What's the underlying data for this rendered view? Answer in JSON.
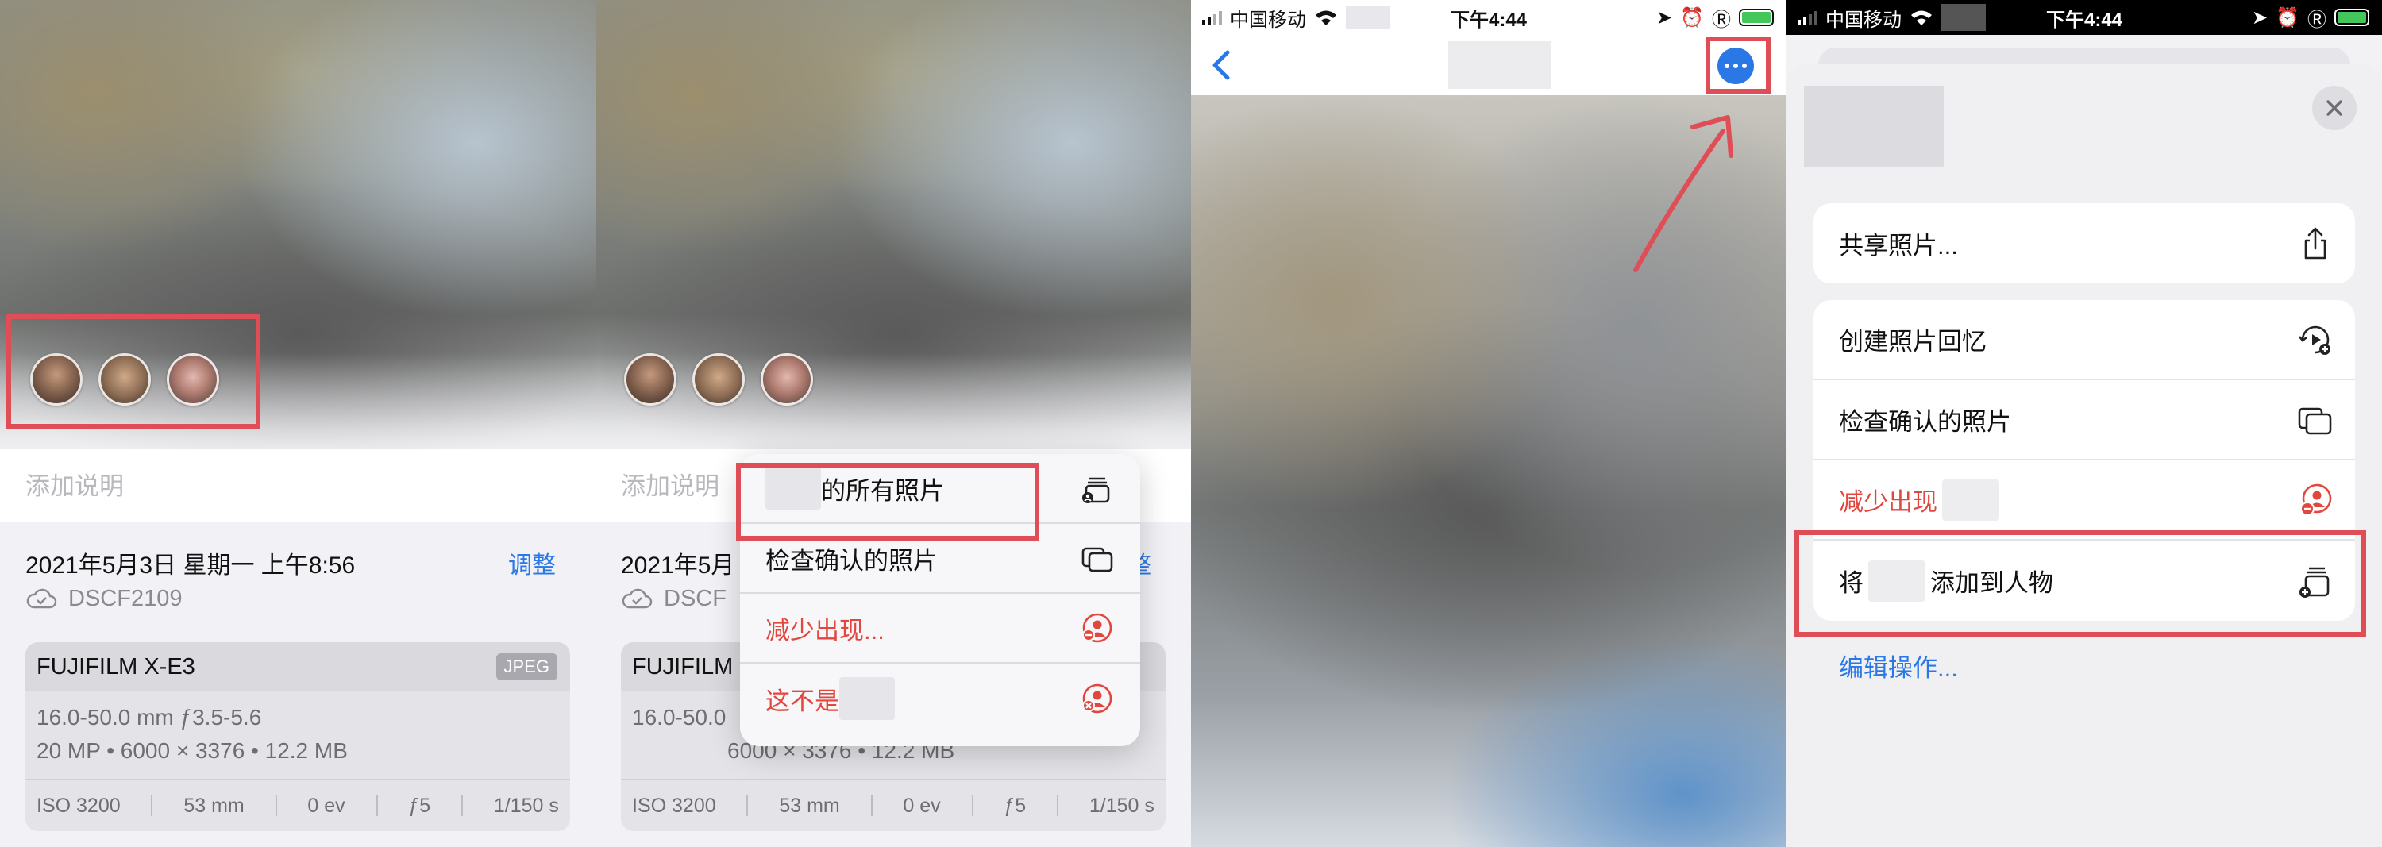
{
  "panel1": {
    "caption_placeholder": "添加说明",
    "date": "2021年5月3日 星期一 上午8:56",
    "adjust": "调整",
    "filename": "DSCF2109",
    "camera": "FUJIFILM X-E3",
    "format_badge": "JPEG",
    "lens": "16.0-50.0 mm ƒ3.5-5.6",
    "specs": "20 MP  •  6000 × 3376  •  12.2 MB",
    "stats": [
      "ISO 3200",
      "53 mm",
      "0 ev",
      "ƒ5",
      "1/150 s"
    ]
  },
  "panel2": {
    "caption_placeholder": "添加说明",
    "date": "2021年5月",
    "adjust": "整",
    "filename": "DSCF",
    "camera": "FUJIFILM X",
    "lens": "16.0-50.0",
    "specs": "6000 × 3376  •  12.2 MB",
    "stats": [
      "ISO 3200",
      "53 mm",
      "0 ev",
      "ƒ5",
      "1/150 s"
    ],
    "menu": {
      "all_photos": "的所有照片",
      "review_confirmed": "检查确认的照片",
      "feature_less": "减少出现...",
      "not_this": "这不是"
    }
  },
  "status_bar": {
    "carrier": "中国移动",
    "time": "下午4:44"
  },
  "panel4": {
    "share_photos": "共享照片...",
    "create_memory": "创建照片回忆",
    "review_confirmed": "检查确认的照片",
    "feature_less": "减少出现",
    "add_prefix": "将",
    "add_suffix": "添加到人物",
    "edit_actions": "编辑操作..."
  },
  "colors": {
    "accent_blue": "#2a78e6",
    "destructive_red": "#e2463d",
    "highlight_box": "#df4d57"
  },
  "icons": [
    "cloud-icon",
    "stack-person-icon",
    "photos-stack-icon",
    "person-minus-icon",
    "person-x-icon",
    "chevron-left-icon",
    "more-icon",
    "share-icon",
    "memory-play-icon",
    "add-to-people-icon",
    "close-icon"
  ]
}
